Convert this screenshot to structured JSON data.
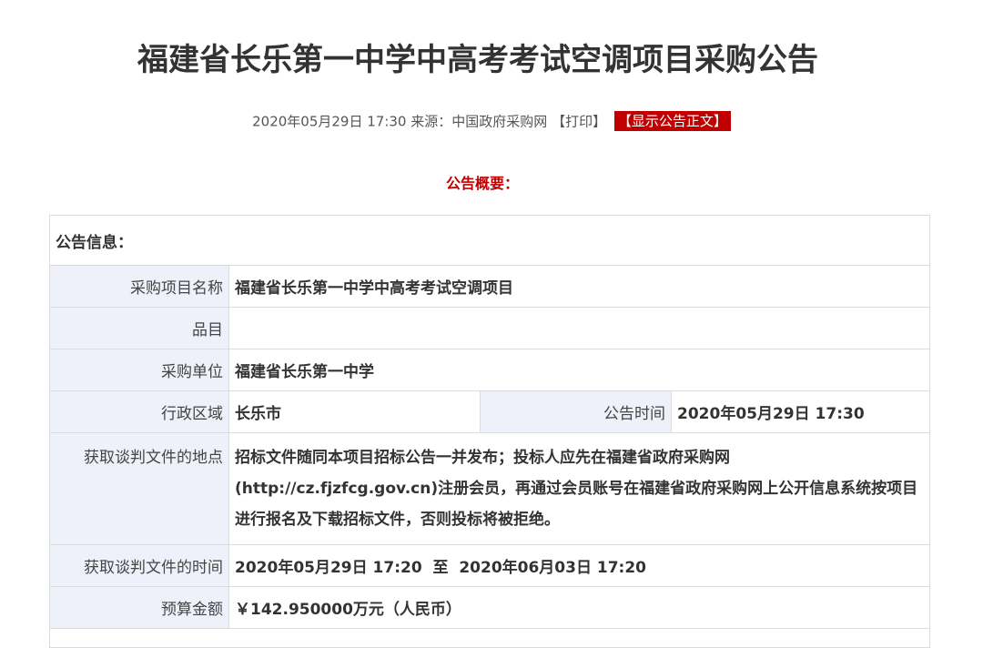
{
  "title": "福建省长乐第一中学中高考考试空调项目采购公告",
  "meta": {
    "datetime": "2020年05月29日 17:30",
    "source_label": "来源：",
    "source": "中国政府采购网",
    "print": "【打印】",
    "show_full": "【显示公告正文】"
  },
  "summary_title": "公告概要：",
  "table": {
    "header": "公告信息：",
    "rows": {
      "project_name": {
        "label": "采购项目名称",
        "value": "福建省长乐第一中学中高考考试空调项目"
      },
      "category": {
        "label": "品目",
        "value": ""
      },
      "purchaser": {
        "label": "采购单位",
        "value": "福建省长乐第一中学"
      },
      "region": {
        "label": "行政区域",
        "value": "长乐市"
      },
      "announce_time": {
        "label": "公告时间",
        "value": "2020年05月29日 17:30"
      },
      "doc_location": {
        "label": "获取谈判文件的地点",
        "value": "招标文件随同本项目招标公告一并发布；投标人应先在福建省政府采购网(http://cz.fjzfcg.gov.cn)注册会员，再通过会员账号在福建省政府采购网上公开信息系统按项目进行报名及下载招标文件，否则投标将被拒绝。"
      },
      "doc_time": {
        "label": "获取谈判文件的时间",
        "value": "2020年05月29日 17:20  至  2020年06月03日 17:20"
      },
      "budget": {
        "label": "预算金额",
        "value": "￥142.950000万元（人民币）"
      }
    }
  }
}
